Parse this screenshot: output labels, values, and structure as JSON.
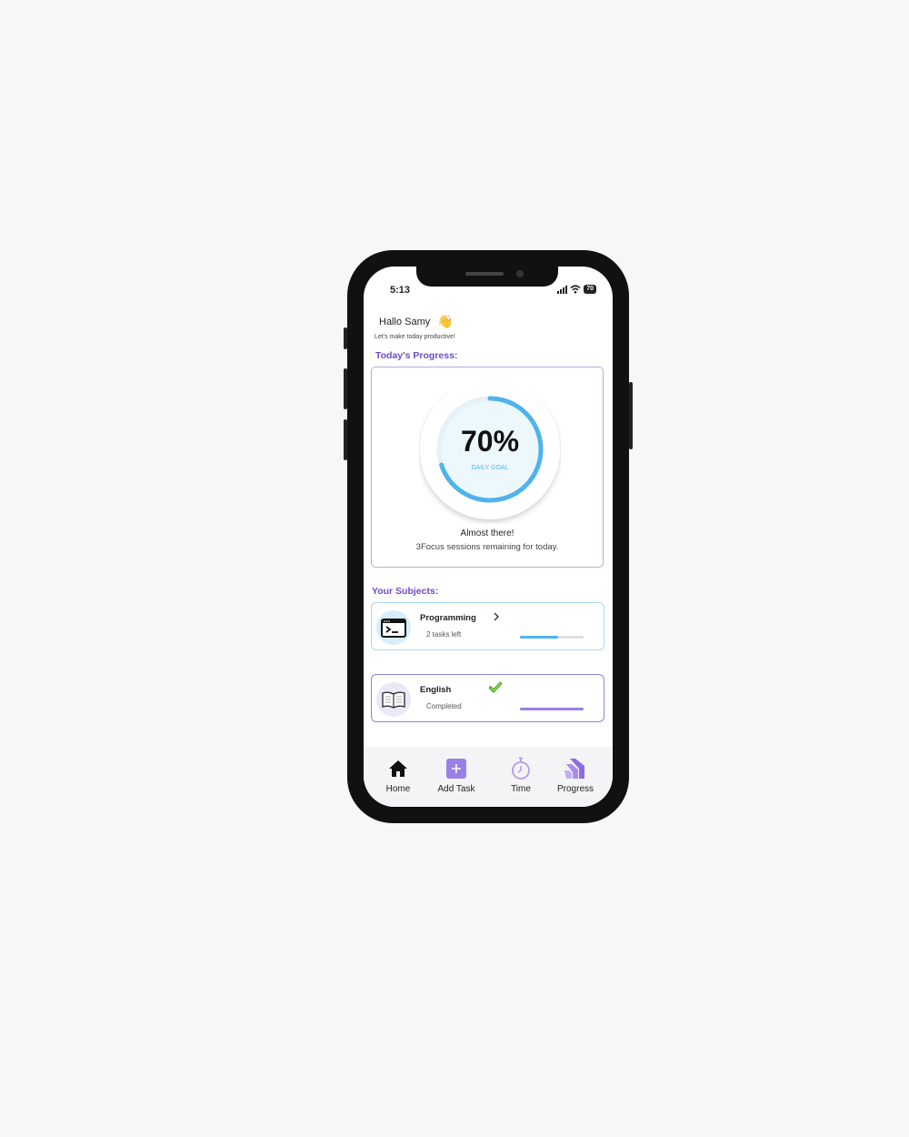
{
  "status_bar": {
    "time": "5:13",
    "battery": "70"
  },
  "header": {
    "greeting": "Hallo Samy",
    "greeting_emoji": "👋",
    "subtitle": "Let's make today productive!"
  },
  "progress": {
    "section_title": "Today's Progress:",
    "percent_text": "70%",
    "percent_value": 70,
    "goal_label": "DAILY GOAL",
    "message": "Almost there!",
    "detail": "3Focus sessions remaining for today.",
    "ring_color": "#4fb3ec"
  },
  "subjects": {
    "section_title": "Your Subjects:",
    "items": [
      {
        "name": "Programming",
        "status": "2 tasks left",
        "icon": "terminal-icon",
        "progress": 0.6,
        "color": "#4fb3ec",
        "accessory": "chevron-right-icon"
      },
      {
        "name": "English",
        "status": "Completed",
        "icon": "book-icon",
        "progress": 1.0,
        "color": "#9a7fe6",
        "accessory": "checkmark-icon"
      }
    ]
  },
  "nav": {
    "items": [
      {
        "label": "Home",
        "icon": "home-icon"
      },
      {
        "label": "Add Task",
        "icon": "add-icon"
      },
      {
        "label": "Time",
        "icon": "stopwatch-icon"
      },
      {
        "label": "Progress",
        "icon": "progress-icon"
      }
    ]
  },
  "colors": {
    "accent": "#6b4cc4",
    "purple": "#9a7fe6",
    "blue": "#4fb3ec"
  }
}
